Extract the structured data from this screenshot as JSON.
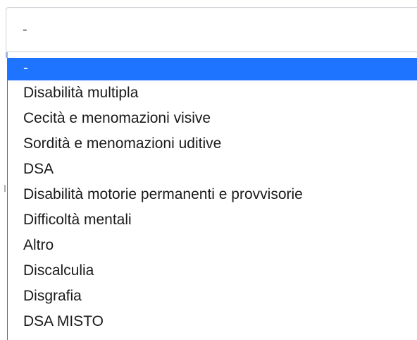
{
  "select": {
    "current_value": "-"
  },
  "dropdown": {
    "options": [
      {
        "label": "-",
        "selected": true
      },
      {
        "label": "Disabilità multipla",
        "selected": false
      },
      {
        "label": "Cecità e menomazioni visive",
        "selected": false
      },
      {
        "label": "Sordità e menomazioni uditive",
        "selected": false
      },
      {
        "label": "DSA",
        "selected": false
      },
      {
        "label": "Disabilità motorie permanenti e provvisorie",
        "selected": false
      },
      {
        "label": "Difficoltà mentali",
        "selected": false
      },
      {
        "label": "Altro",
        "selected": false
      },
      {
        "label": "Discalculia",
        "selected": false
      },
      {
        "label": "Disgrafia",
        "selected": false
      },
      {
        "label": "DSA MISTO",
        "selected": false
      }
    ]
  },
  "colors": {
    "highlight": "#1e73ff",
    "text": "#1a1a1a",
    "border": "#cfd4da"
  }
}
